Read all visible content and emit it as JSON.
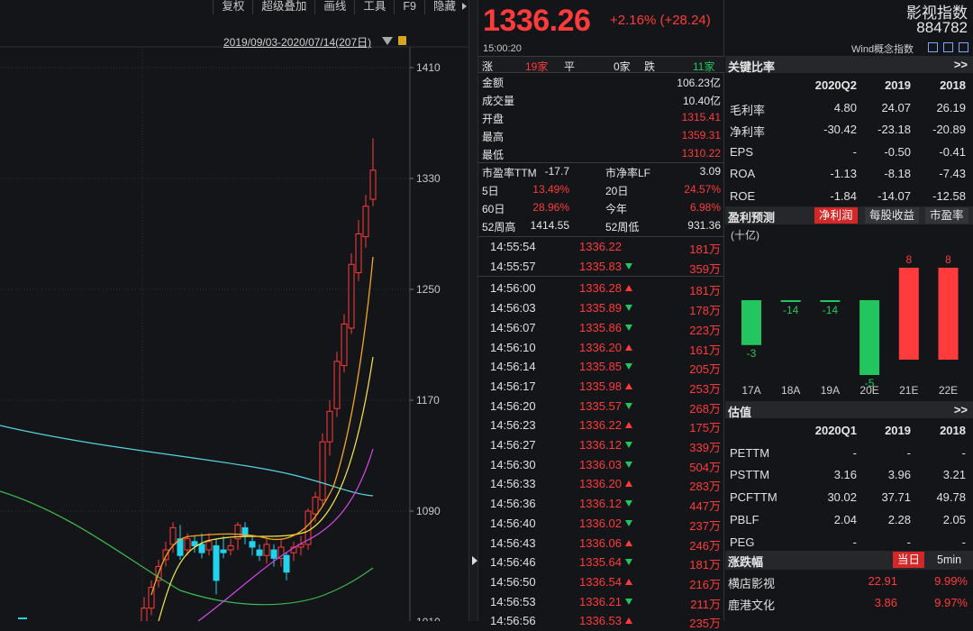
{
  "toolbar": {
    "items": [
      "复权",
      "超级叠加",
      "画线",
      "工具",
      "F9",
      "隐藏"
    ]
  },
  "chart": {
    "date_range": "2019/09/03-2020/07/14(207日)",
    "price_ticks": [
      "1410",
      "1330",
      "1250",
      "1170",
      "1090",
      "1010"
    ]
  },
  "quote": {
    "last": "1336.26",
    "change": "+2.16% (+28.24)",
    "time": "15:00:20",
    "breadth": {
      "up_label": "涨",
      "up_count": "19家",
      "flat_label": "平",
      "flat_count": "0家",
      "down_label": "跌",
      "down_count": "11家"
    },
    "rows": [
      {
        "label": "金额",
        "value": "106.23亿",
        "color": "white"
      },
      {
        "label": "成交量",
        "value": "10.40亿",
        "color": "white"
      },
      {
        "label": "开盘",
        "value": "1315.41",
        "color": "red"
      },
      {
        "label": "最高",
        "value": "1359.31",
        "color": "red"
      },
      {
        "label": "最低",
        "value": "1310.22",
        "color": "red"
      }
    ],
    "pairs": [
      {
        "l1": "市盈率TTM",
        "v1": "-17.7",
        "c1": "white",
        "l2": "市净率LF",
        "v2": "3.09",
        "c2": "white"
      },
      {
        "l1": "5日",
        "v1": "13.49%",
        "c1": "red",
        "l2": "20日",
        "v2": "24.57%",
        "c2": "red"
      },
      {
        "l1": "60日",
        "v1": "28.96%",
        "c1": "red",
        "l2": "今年",
        "v2": "6.98%",
        "c2": "red"
      },
      {
        "l1": "52周高",
        "v1": "1414.55",
        "c1": "white",
        "l2": "52周低",
        "v2": "931.36",
        "c2": "white"
      }
    ],
    "ticks": [
      {
        "t": "14:55:54",
        "p": "1336.22",
        "d": "",
        "v": "181万"
      },
      {
        "t": "14:55:57",
        "p": "1335.83",
        "d": "down",
        "v": "359万"
      },
      {
        "t": "14:56:00",
        "p": "1336.28",
        "d": "up",
        "v": "181万"
      },
      {
        "t": "14:56:03",
        "p": "1335.89",
        "d": "down",
        "v": "178万"
      },
      {
        "t": "14:56:07",
        "p": "1335.86",
        "d": "down",
        "v": "223万"
      },
      {
        "t": "14:56:10",
        "p": "1336.20",
        "d": "up",
        "v": "161万"
      },
      {
        "t": "14:56:14",
        "p": "1335.85",
        "d": "down",
        "v": "205万"
      },
      {
        "t": "14:56:17",
        "p": "1335.98",
        "d": "up",
        "v": "253万"
      },
      {
        "t": "14:56:20",
        "p": "1335.57",
        "d": "down",
        "v": "268万"
      },
      {
        "t": "14:56:23",
        "p": "1336.22",
        "d": "up",
        "v": "175万"
      },
      {
        "t": "14:56:27",
        "p": "1336.12",
        "d": "down",
        "v": "339万"
      },
      {
        "t": "14:56:30",
        "p": "1336.03",
        "d": "down",
        "v": "504万"
      },
      {
        "t": "14:56:33",
        "p": "1336.20",
        "d": "up",
        "v": "283万"
      },
      {
        "t": "14:56:36",
        "p": "1336.12",
        "d": "down",
        "v": "447万"
      },
      {
        "t": "14:56:40",
        "p": "1336.02",
        "d": "down",
        "v": "237万"
      },
      {
        "t": "14:56:43",
        "p": "1336.06",
        "d": "up",
        "v": "246万"
      },
      {
        "t": "14:56:46",
        "p": "1335.64",
        "d": "down",
        "v": "181万"
      },
      {
        "t": "14:56:50",
        "p": "1336.54",
        "d": "up",
        "v": "216万"
      },
      {
        "t": "14:56:53",
        "p": "1336.21",
        "d": "down",
        "v": "211万"
      },
      {
        "t": "14:56:56",
        "p": "1336.53",
        "d": "up",
        "v": "235万"
      }
    ]
  },
  "info": {
    "name": "影视指数",
    "code": "884782",
    "wind_label": "Wind概念指数",
    "ratios": {
      "title": "关键比率",
      "more": ">>",
      "headers": [
        "",
        "2020Q2",
        "2019",
        "2018"
      ],
      "rows": [
        [
          "毛利率",
          "4.80",
          "24.07",
          "26.19"
        ],
        [
          "净利率",
          "-30.42",
          "-23.18",
          "-20.89"
        ],
        [
          "EPS",
          "-",
          "-0.50",
          "-0.41"
        ],
        [
          "ROA",
          "-1.13",
          "-8.18",
          "-7.43"
        ],
        [
          "ROE",
          "-1.84",
          "-14.07",
          "-12.58"
        ]
      ]
    },
    "forecast": {
      "title": "盈利预测",
      "tabs": [
        "净利润",
        "每股收益",
        "市盈率"
      ],
      "unit": "(十亿)"
    },
    "valuation": {
      "title": "估值",
      "more": ">>",
      "headers": [
        "",
        "2020Q1",
        "2019",
        "2018"
      ],
      "rows": [
        [
          "PETTM",
          "-",
          "-",
          "-"
        ],
        [
          "PSTTM",
          "3.16",
          "3.96",
          "3.21"
        ],
        [
          "PCFTTM",
          "30.02",
          "37.71",
          "49.78"
        ],
        [
          "PBLF",
          "2.04",
          "2.28",
          "2.05"
        ],
        [
          "PEG",
          "-",
          "-",
          "-"
        ]
      ]
    },
    "movers": {
      "title": "涨跌幅",
      "tabs": [
        "当日",
        "5min"
      ],
      "rows": [
        {
          "name": "横店影视",
          "price": "22.91",
          "pct": "9.99%"
        },
        {
          "name": "鹿港文化",
          "price": "3.86",
          "pct": "9.97%"
        }
      ]
    }
  },
  "chart_data": {
    "type": "bar",
    "categories": [
      "17A",
      "18A",
      "19A",
      "20E",
      "21E",
      "22E"
    ],
    "values": [
      -3,
      -14,
      -14,
      -5,
      8,
      8
    ],
    "title": "",
    "xlabel": "",
    "ylabel": "(十亿)"
  }
}
